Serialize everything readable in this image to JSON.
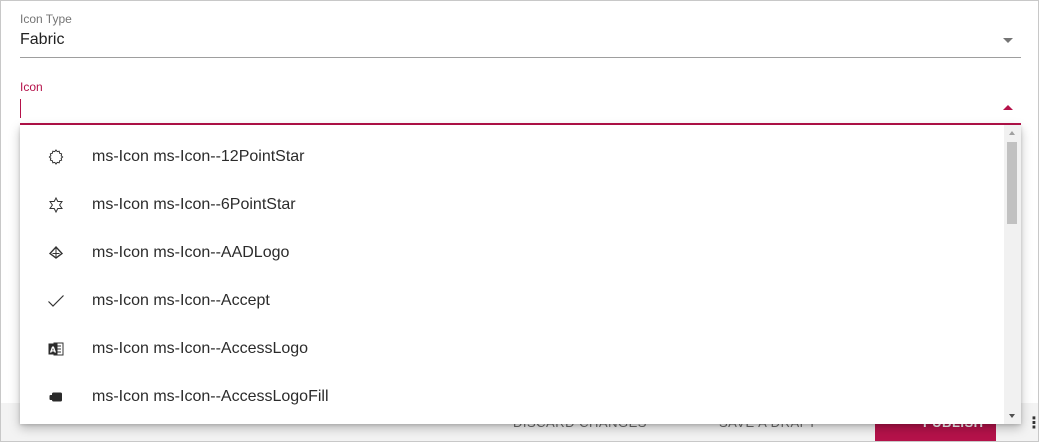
{
  "icon_type_field": {
    "label": "Icon Type",
    "value": "Fabric"
  },
  "icon_field": {
    "label": "Icon",
    "value": ""
  },
  "dropdown": {
    "options": [
      {
        "label": "ms-Icon ms-Icon--12PointStar",
        "icon": "twelve-point-star-icon"
      },
      {
        "label": "ms-Icon ms-Icon--6PointStar",
        "icon": "six-point-star-icon"
      },
      {
        "label": "ms-Icon ms-Icon--AADLogo",
        "icon": "aad-logo-icon"
      },
      {
        "label": "ms-Icon ms-Icon--Accept",
        "icon": "checkmark-icon"
      },
      {
        "label": "ms-Icon ms-Icon--AccessLogo",
        "icon": "access-logo-icon"
      },
      {
        "label": "ms-Icon ms-Icon--AccessLogoFill",
        "icon": "access-logo-fill-icon"
      }
    ]
  },
  "toolbar": {
    "discard_label": "DISCARD CHANGES",
    "draft_label": "SAVE A DRAFT",
    "publish_label": "PUBLISH"
  },
  "colors": {
    "accent": "#b5124a",
    "text": "#212121",
    "label": "#757575"
  }
}
